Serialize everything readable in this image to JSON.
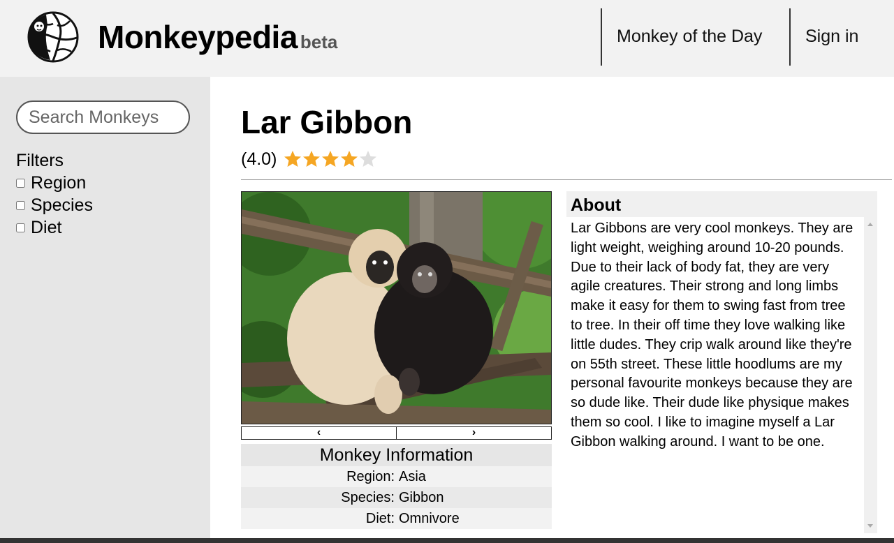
{
  "header": {
    "logo_icon": "monkey-globe-logo",
    "brand": "Monkeypedia",
    "badge": "beta",
    "nav": [
      "Monkey of the Day",
      "Sign in"
    ]
  },
  "sidebar": {
    "search_placeholder": "Search Monkeys",
    "filters_title": "Filters",
    "filters": [
      "Region",
      "Species",
      "Diet"
    ]
  },
  "main": {
    "title": "Lar Gibbon",
    "rating_text": "(4.0)",
    "rating_value": 4.0,
    "rating_max": 5,
    "star_color": "#f5a623",
    "carousel": {
      "prev": "‹",
      "next": "›"
    },
    "info": {
      "title": "Monkey Information",
      "rows": [
        {
          "key": "Region:",
          "value": "Asia"
        },
        {
          "key": "Species:",
          "value": "Gibbon"
        },
        {
          "key": "Diet:",
          "value": "Omnivore"
        }
      ]
    },
    "about": {
      "title": "About",
      "text": "Lar Gibbons are very cool monkeys. They are light weight, weighing around 10-20 pounds. Due to their lack of body fat, they are very agile creatures. Their strong and long limbs make it easy for them to swing fast from tree to tree. In their off time they love walking like little dudes. They crip walk around like they're on 55th street. These little hoodlums are my personal favourite monkeys because they are so dude like. Their dude like physique makes them so cool. I like to imagine myself a Lar Gibbon walking around. I want to be one."
    }
  }
}
